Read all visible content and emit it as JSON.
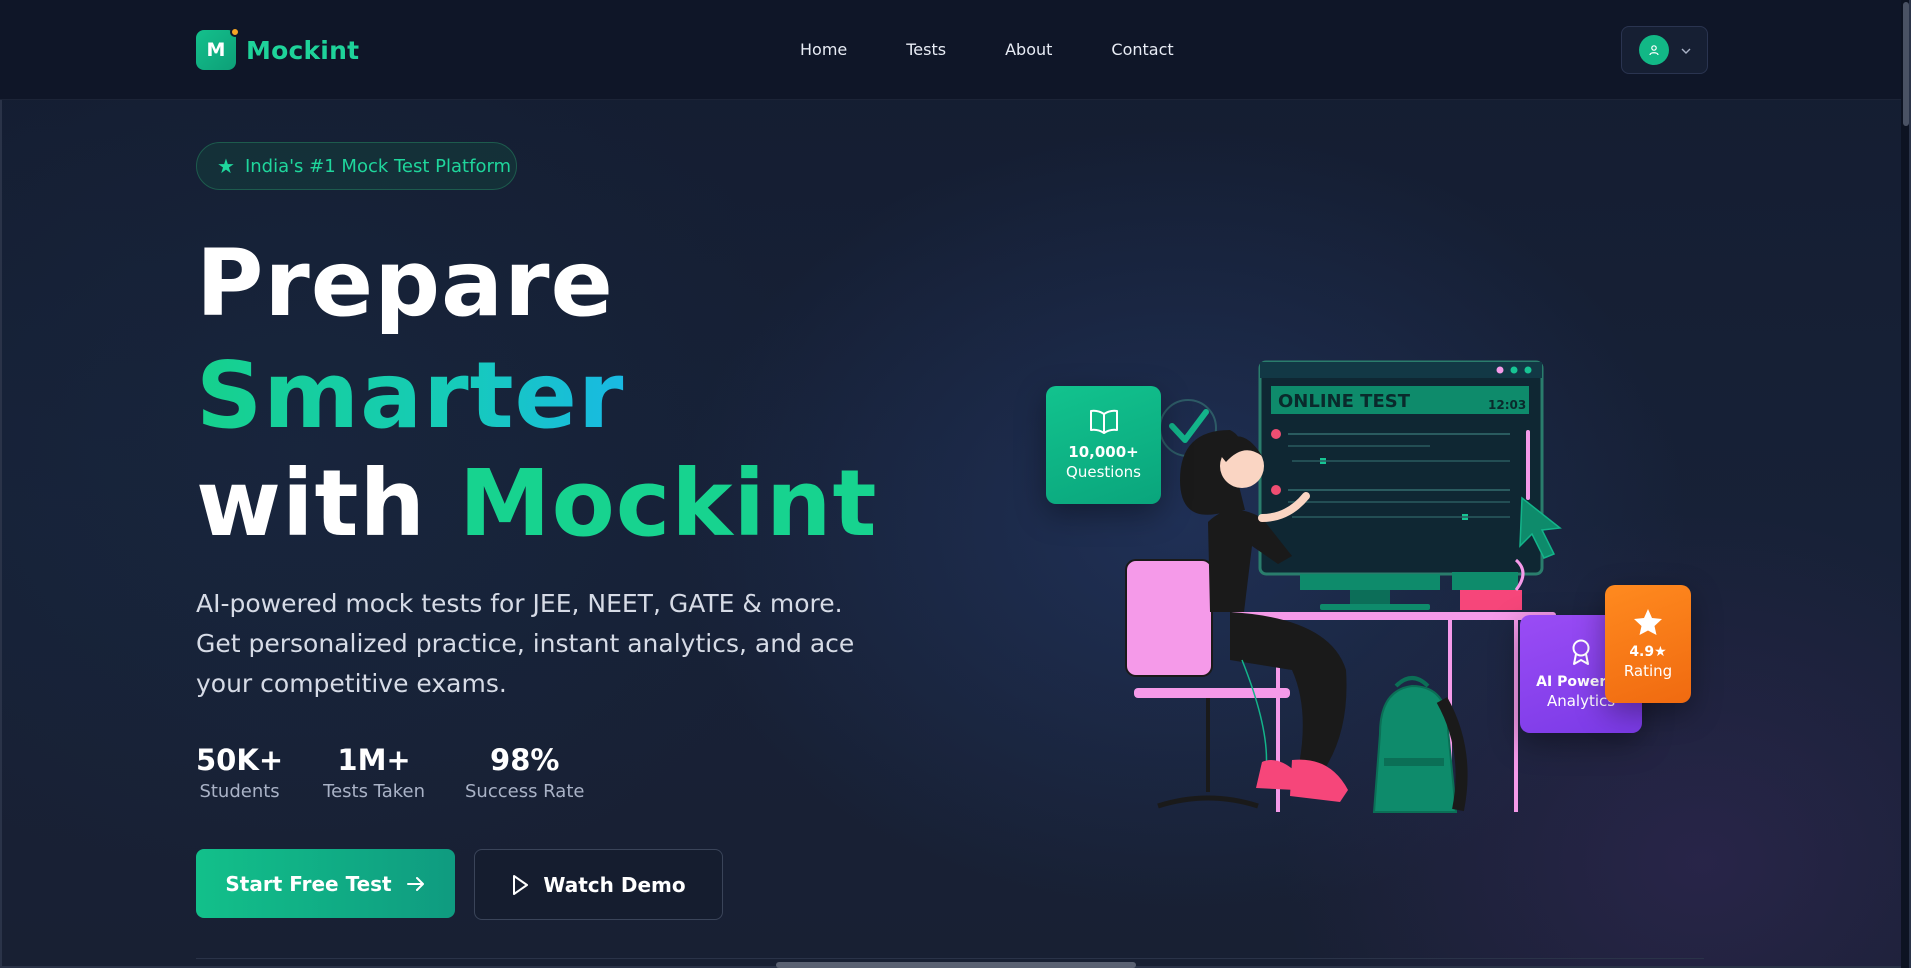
{
  "brand": {
    "logo_letter": "M",
    "name": "Mockint",
    "accent": "#1ed39a",
    "primary_gradient": [
      "#12c08a",
      "#0f9b80"
    ]
  },
  "nav": {
    "links": [
      "Home",
      "Tests",
      "About",
      "Contact"
    ],
    "user_icon": "user-icon",
    "menu_icon": "chevron-down-icon"
  },
  "hero": {
    "badge_text": "India's #1 Mock Test Platform",
    "headline_line1": "Prepare",
    "headline_line2": "Smarter",
    "headline_line3_prefix": "with",
    "headline_line3_accent": "Mockint",
    "subtitle": "AI-powered mock tests for JEE, NEET, GATE & more. Get personalized practice, instant analytics, and ace your competitive exams.",
    "stats": [
      {
        "value": "50K+",
        "label": "Students"
      },
      {
        "value": "1M+",
        "label": "Tests Taken"
      },
      {
        "value": "98%",
        "label": "Success Rate"
      }
    ],
    "primary_cta": "Start Free Test",
    "secondary_cta": "Watch Demo"
  },
  "illustration": {
    "screen_title": "ONLINE TEST",
    "screen_time": "12:03",
    "card_questions": {
      "value": "10,000+",
      "label": "Questions"
    },
    "card_ai": {
      "value": "AI Powered",
      "label": "Analytics"
    },
    "card_rating": {
      "value": "4.9★",
      "label": "Rating"
    },
    "colors": {
      "teal": "#0e8b6b",
      "pink": "#f69bf0",
      "purple": "#8a44f0",
      "orange": "#ff7f18"
    }
  }
}
